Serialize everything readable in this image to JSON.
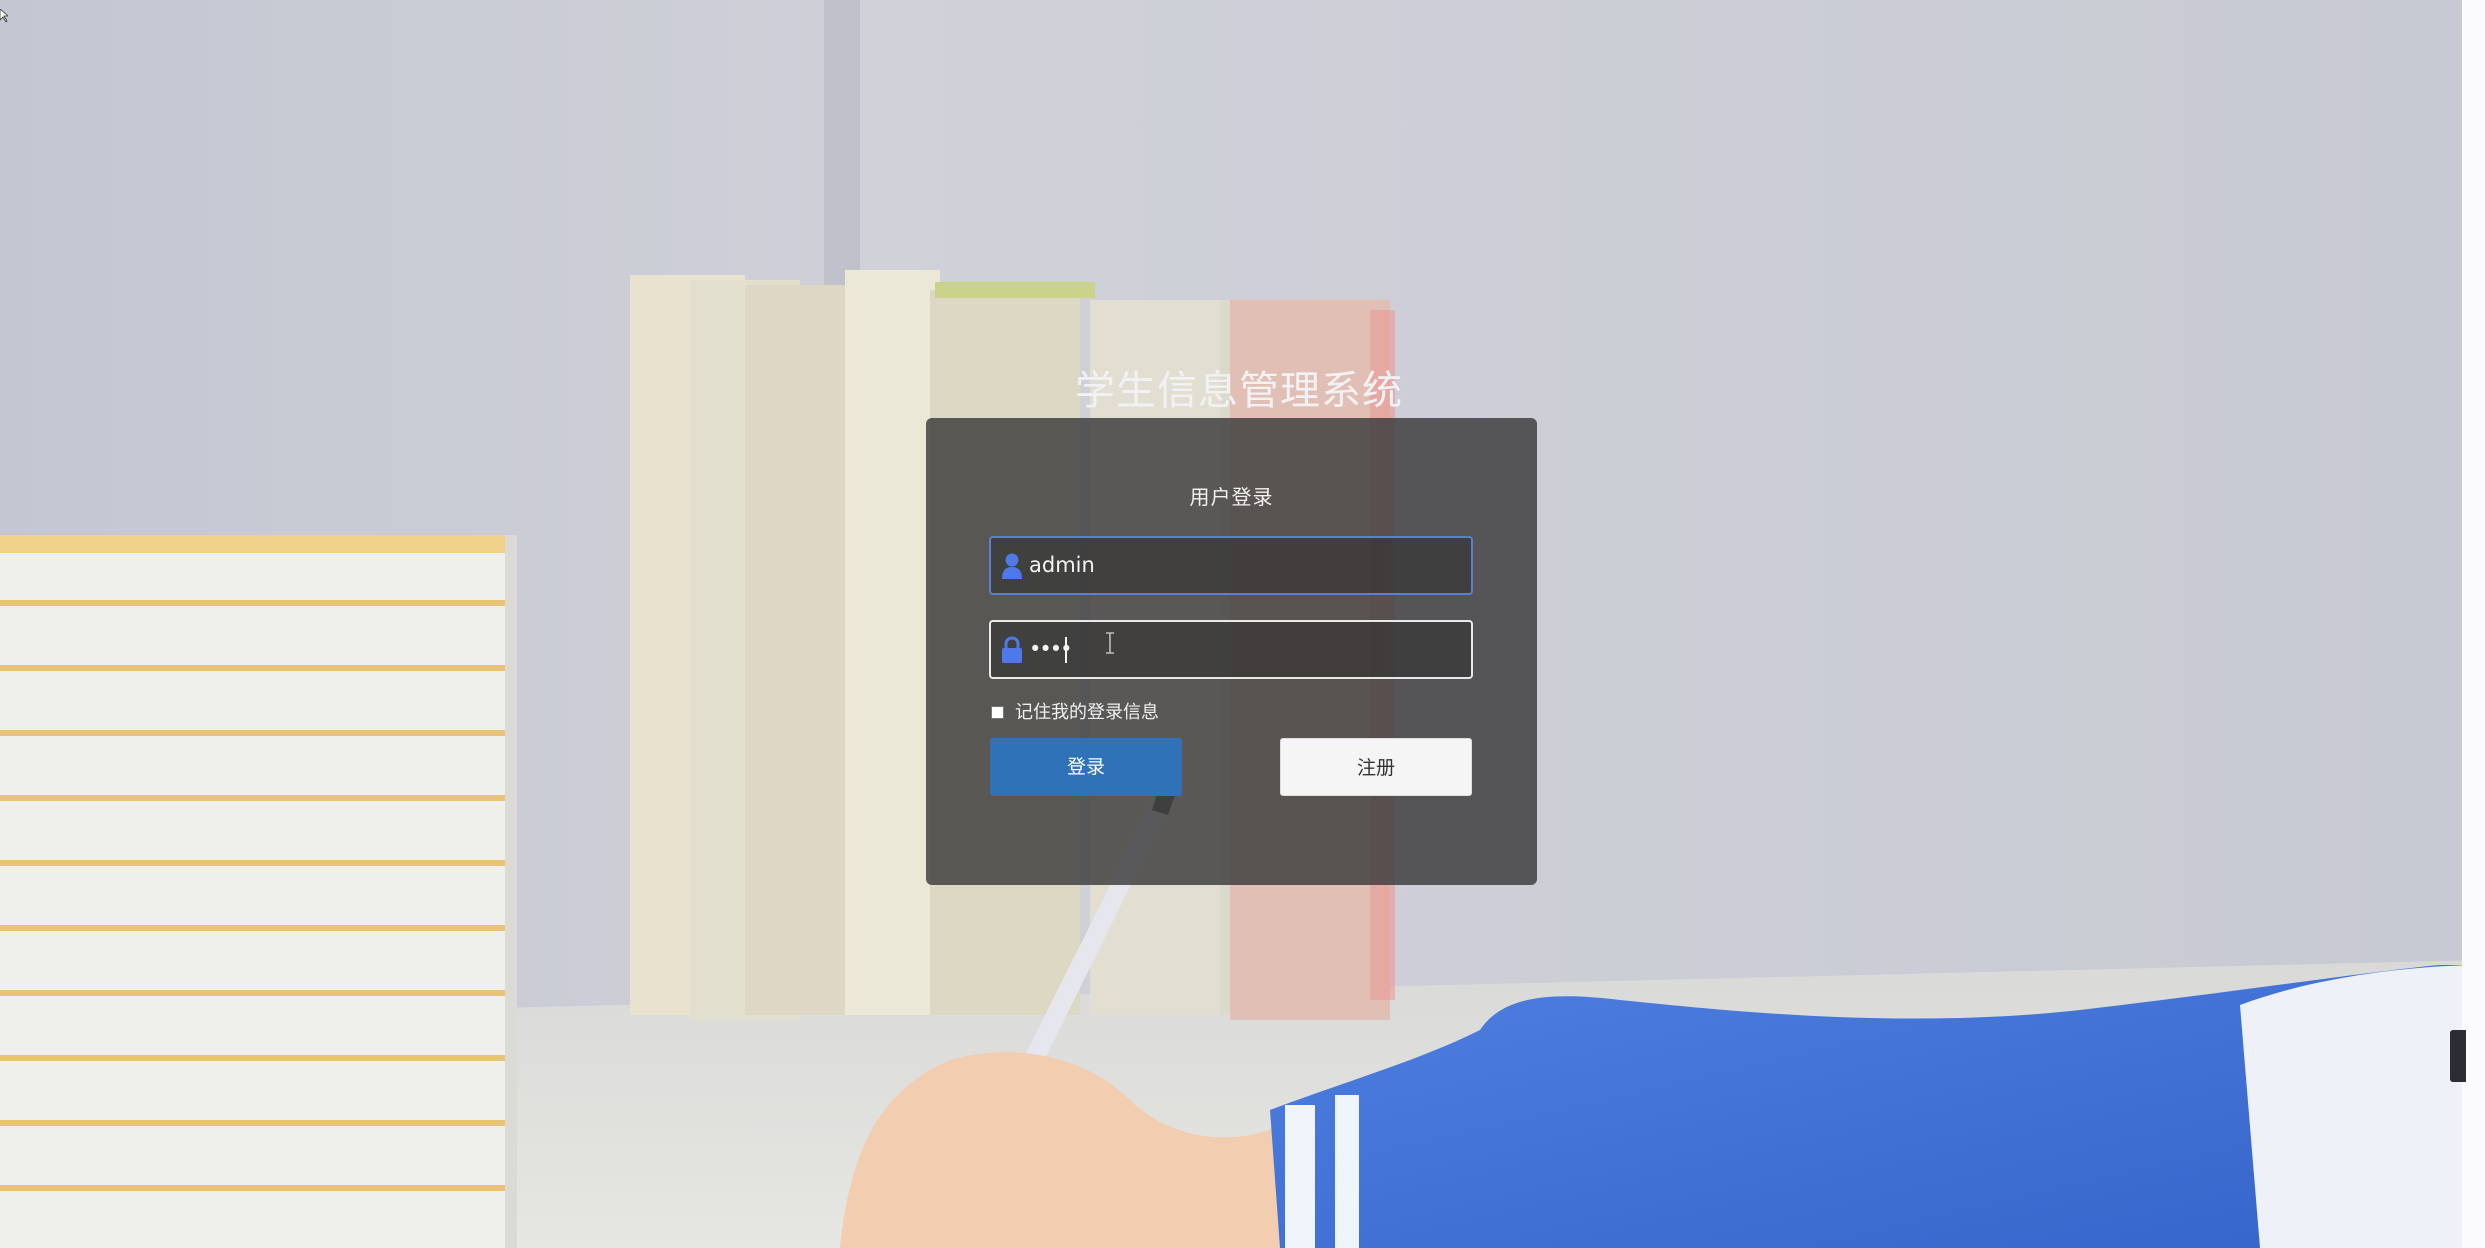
{
  "app": {
    "title": "学生信息管理系统"
  },
  "login_panel": {
    "title": "用户登录",
    "username": {
      "icon": "user-icon",
      "value": "admin"
    },
    "password": {
      "icon": "lock-icon",
      "masked_value": "••••"
    },
    "remember": {
      "label": "记住我的登录信息",
      "checked": false
    },
    "buttons": {
      "login_label": "登录",
      "register_label": "注册"
    }
  },
  "colors": {
    "accent": "#2f72b8",
    "input_focus_border": "#5b7fd2",
    "icon_blue": "#4f79e8",
    "panel_bg": "#3e3e3e"
  }
}
